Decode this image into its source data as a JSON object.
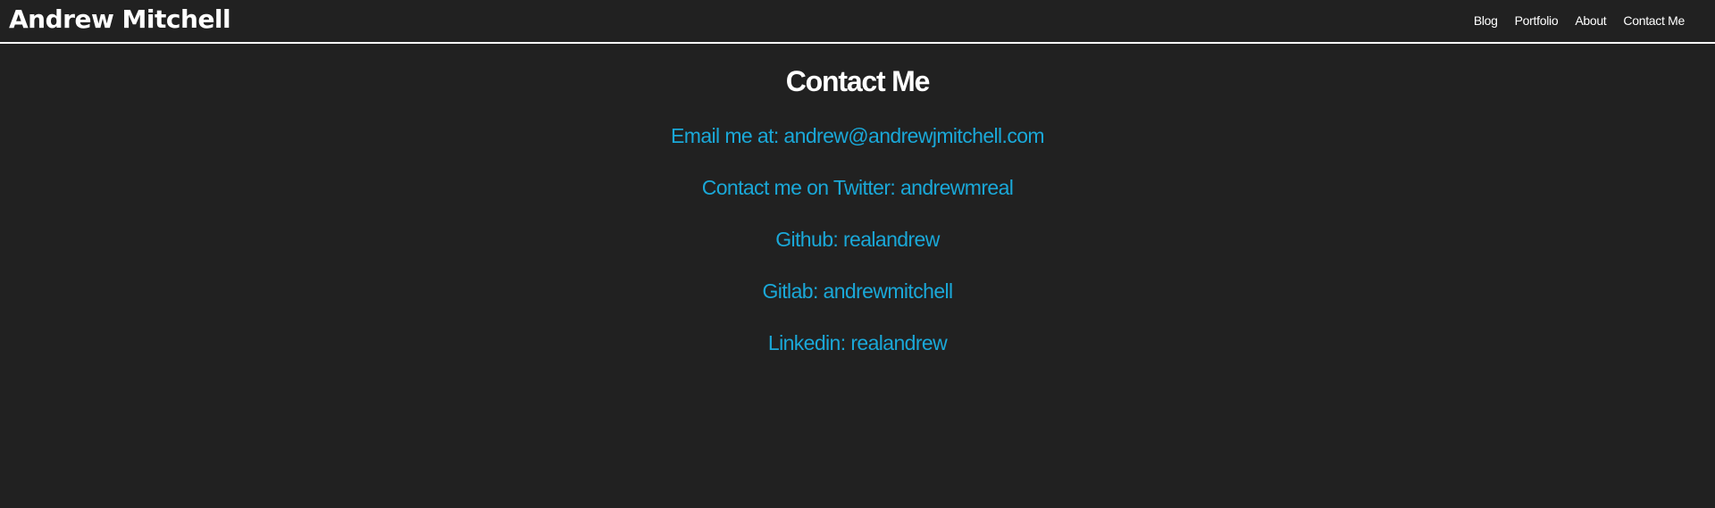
{
  "header": {
    "brand": "Andrew Mitchell",
    "nav": [
      {
        "label": "Blog"
      },
      {
        "label": "Portfolio"
      },
      {
        "label": "About"
      },
      {
        "label": "Contact Me"
      }
    ]
  },
  "main": {
    "title": "Contact Me",
    "contacts": [
      {
        "label": "Email me at: andrew@andrewjmitchell.com"
      },
      {
        "label": "Contact me on Twitter: andrewmreal"
      },
      {
        "label": "Github: realandrew"
      },
      {
        "label": "Gitlab: andrewmitchell"
      },
      {
        "label": "Linkedin: realandrew"
      }
    ]
  },
  "colors": {
    "background": "#212121",
    "text": "#ffffff",
    "link": "#1aa8d8",
    "divider": "#ffffff"
  }
}
